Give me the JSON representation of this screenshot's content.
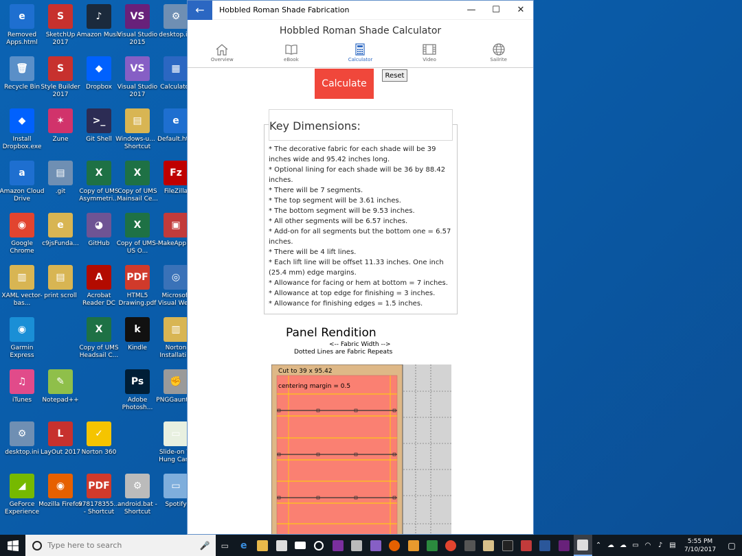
{
  "desktop": {
    "icons": [
      {
        "label": "Removed Apps.html",
        "glyph": "e",
        "color": "#1e6fd0",
        "col": 0,
        "row": 0
      },
      {
        "label": "SketchUp 2017",
        "glyph": "S",
        "color": "#c7312e",
        "col": 1,
        "row": 0
      },
      {
        "label": "Amazon Music",
        "glyph": "♪",
        "color": "#1b2a3c",
        "col": 2,
        "row": 0
      },
      {
        "label": "Visual Studio 2015",
        "glyph": "VS",
        "color": "#68217a",
        "col": 3,
        "row": 0
      },
      {
        "label": "desktop.ini",
        "glyph": "⚙",
        "color": "#6f8fb3",
        "col": 4,
        "row": 0
      },
      {
        "label": "Recycle Bin",
        "glyph": "🗑",
        "color": "#5a8fc8",
        "col": 0,
        "row": 1
      },
      {
        "label": "Style Builder 2017",
        "glyph": "S",
        "color": "#c7312e",
        "col": 1,
        "row": 1
      },
      {
        "label": "Dropbox",
        "glyph": "◆",
        "color": "#0061fe",
        "col": 2,
        "row": 1
      },
      {
        "label": "Visual Studio 2017",
        "glyph": "VS",
        "color": "#865fc5",
        "col": 3,
        "row": 1
      },
      {
        "label": "Calculator",
        "glyph": "▦",
        "color": "#2b67c2",
        "col": 4,
        "row": 1
      },
      {
        "label": "Install Dropbox.exe",
        "glyph": "◆",
        "color": "#0061fe",
        "col": 0,
        "row": 2
      },
      {
        "label": "Zune",
        "glyph": "✶",
        "color": "#d1336b",
        "col": 1,
        "row": 2
      },
      {
        "label": "Git Shell",
        "glyph": ">_",
        "color": "#2c2c54",
        "col": 2,
        "row": 2
      },
      {
        "label": "Windows-u... - Shortcut",
        "glyph": "▤",
        "color": "#d8b553",
        "col": 3,
        "row": 2
      },
      {
        "label": "Default.htm",
        "glyph": "e",
        "color": "#1e6fd0",
        "col": 4,
        "row": 2
      },
      {
        "label": "Amazon Cloud Drive",
        "glyph": "a",
        "color": "#1e6fd0",
        "col": 0,
        "row": 3
      },
      {
        "label": ".git",
        "glyph": "▤",
        "color": "#6f8fb3",
        "col": 1,
        "row": 3
      },
      {
        "label": "Copy of UMS Asymmetri...",
        "glyph": "X",
        "color": "#1e7145",
        "col": 2,
        "row": 3
      },
      {
        "label": "Copy of UMS Mainsail Ce...",
        "glyph": "X",
        "color": "#1e7145",
        "col": 3,
        "row": 3
      },
      {
        "label": "FileZilla",
        "glyph": "Fz",
        "color": "#bf0000",
        "col": 4,
        "row": 3
      },
      {
        "label": "Google Chrome",
        "glyph": "◉",
        "color": "#e2442f",
        "col": 0,
        "row": 4
      },
      {
        "label": "c9jsFunda...",
        "glyph": "e",
        "color": "#d8b553",
        "col": 1,
        "row": 4
      },
      {
        "label": "GitHub",
        "glyph": "◕",
        "color": "#6e5494",
        "col": 2,
        "row": 4
      },
      {
        "label": "Copy of UMS-US O...",
        "glyph": "X",
        "color": "#1e7145",
        "col": 3,
        "row": 4
      },
      {
        "label": "MakeAppl...",
        "glyph": "▣",
        "color": "#c23b3b",
        "col": 4,
        "row": 4
      },
      {
        "label": "XAML vector-bas...",
        "glyph": "▥",
        "color": "#d8b553",
        "col": 0,
        "row": 5
      },
      {
        "label": "print scroll",
        "glyph": "▤",
        "color": "#d8b553",
        "col": 1,
        "row": 5
      },
      {
        "label": "Acrobat Reader DC",
        "glyph": "A",
        "color": "#b30b00",
        "col": 2,
        "row": 5
      },
      {
        "label": "HTML5 Drawing.pdf",
        "glyph": "PDF",
        "color": "#d03a2b",
        "col": 3,
        "row": 5
      },
      {
        "label": "Microsoft Visual We...",
        "glyph": "◎",
        "color": "#3a72b8",
        "col": 4,
        "row": 5
      },
      {
        "label": "Garmin Express",
        "glyph": "◉",
        "color": "#1a8fd6",
        "col": 0,
        "row": 6
      },
      {
        "label": "Copy of UMS Headsail C...",
        "glyph": "X",
        "color": "#1e7145",
        "col": 2,
        "row": 6
      },
      {
        "label": "Kindle",
        "glyph": "k",
        "color": "#111111",
        "col": 3,
        "row": 6
      },
      {
        "label": "Norton Installati...",
        "glyph": "▥",
        "color": "#d8b553",
        "col": 4,
        "row": 6
      },
      {
        "label": "iTunes",
        "glyph": "♫",
        "color": "#e14b8a",
        "col": 0,
        "row": 7
      },
      {
        "label": "Notepad++",
        "glyph": "✎",
        "color": "#8fbf4a",
        "col": 1,
        "row": 7
      },
      {
        "label": "Adobe Photosh...",
        "glyph": "Ps",
        "color": "#001e36",
        "col": 3,
        "row": 7
      },
      {
        "label": "PNGGauntl...",
        "glyph": "✊",
        "color": "#9a9a9a",
        "col": 4,
        "row": 7
      },
      {
        "label": "desktop.ini",
        "glyph": "⚙",
        "color": "#6f8fb3",
        "col": 0,
        "row": 8
      },
      {
        "label": "LayOut 2017",
        "glyph": "L",
        "color": "#c7312e",
        "col": 1,
        "row": 8
      },
      {
        "label": "Norton 360",
        "glyph": "✓",
        "color": "#f5c400",
        "col": 2,
        "row": 8
      },
      {
        "label": "Slide-on W Hung Cano",
        "glyph": "▭",
        "color": "#e8f0e0",
        "col": 4,
        "row": 8
      },
      {
        "label": "GeForce Experience",
        "glyph": "◢",
        "color": "#76b900",
        "col": 0,
        "row": 9
      },
      {
        "label": "Mozilla Firefox",
        "glyph": "◉",
        "color": "#e66000",
        "col": 1,
        "row": 9
      },
      {
        "label": "978178355... - Shortcut",
        "glyph": "PDF",
        "color": "#d03a2b",
        "col": 2,
        "row": 9
      },
      {
        "label": "android.bat - Shortcut",
        "glyph": "⚙",
        "color": "#bbbbbb",
        "col": 3,
        "row": 9
      },
      {
        "label": "Spotify",
        "glyph": "▭",
        "color": "#7faedc",
        "col": 4,
        "row": 9
      }
    ]
  },
  "window": {
    "title": "Hobbled Roman Shade Fabrication",
    "heading": "Hobbled Roman Shade Calculator",
    "controls": {
      "minimize": "—",
      "maximize": "☐",
      "close": "✕"
    },
    "back_glyph": "←"
  },
  "nav": {
    "items": [
      {
        "label": "Overview",
        "icon": "home-icon"
      },
      {
        "label": "eBook",
        "icon": "book-icon"
      },
      {
        "label": "Calculator",
        "icon": "calculator-icon"
      },
      {
        "label": "Video",
        "icon": "film-icon"
      },
      {
        "label": "Sailrite",
        "icon": "globe-icon"
      }
    ],
    "active": "Calculator",
    "active_color": "#2b67c2"
  },
  "buttons": {
    "calculate": "Calculate",
    "reset": "Reset",
    "calculate_color": "#f0473b"
  },
  "dimensions": {
    "title": "Key Dimensions:",
    "lines": [
      "* The decorative fabric for each shade will be 39 inches wide and 95.42 inches long.",
      "* Optional lining for each shade will be 36 by 88.42 inches.",
      "* There will be 7 segments.",
      "* The top segment will be 3.61 inches.",
      "* The bottom segment will be 9.53 inches.",
      "* All other segments will be 6.57 inches.",
      "* Add-on for all segments but the bottom one = 6.57 inches.",
      "* There will be 4 lift lines.",
      "* Each lift line will be offset 11.33 inches. One inch (25.4 mm) edge margins.",
      "* Allowance for facing or hem at bottom = 7 inches.",
      "* Allowance at top edge for finishing = 3 inches.",
      "* Allowance for finishing edges = 1.5 inches."
    ]
  },
  "panel": {
    "title": "Panel Rendition",
    "subtitle1": "<-- Fabric Width -->",
    "subtitle2": "Dotted Lines are Fabric Repeats",
    "cut_label": "Cut to 39 x 95.42",
    "margin_label": "centering margin = 0.5",
    "colors": {
      "outer": "#deb887",
      "inner": "#fa8072",
      "bg": "#d3d3d3",
      "fold": "#ffd700"
    }
  },
  "taskbar": {
    "search_placeholder": "Type here to search",
    "clock_time": "5:55 PM",
    "clock_date": "7/10/2017"
  }
}
